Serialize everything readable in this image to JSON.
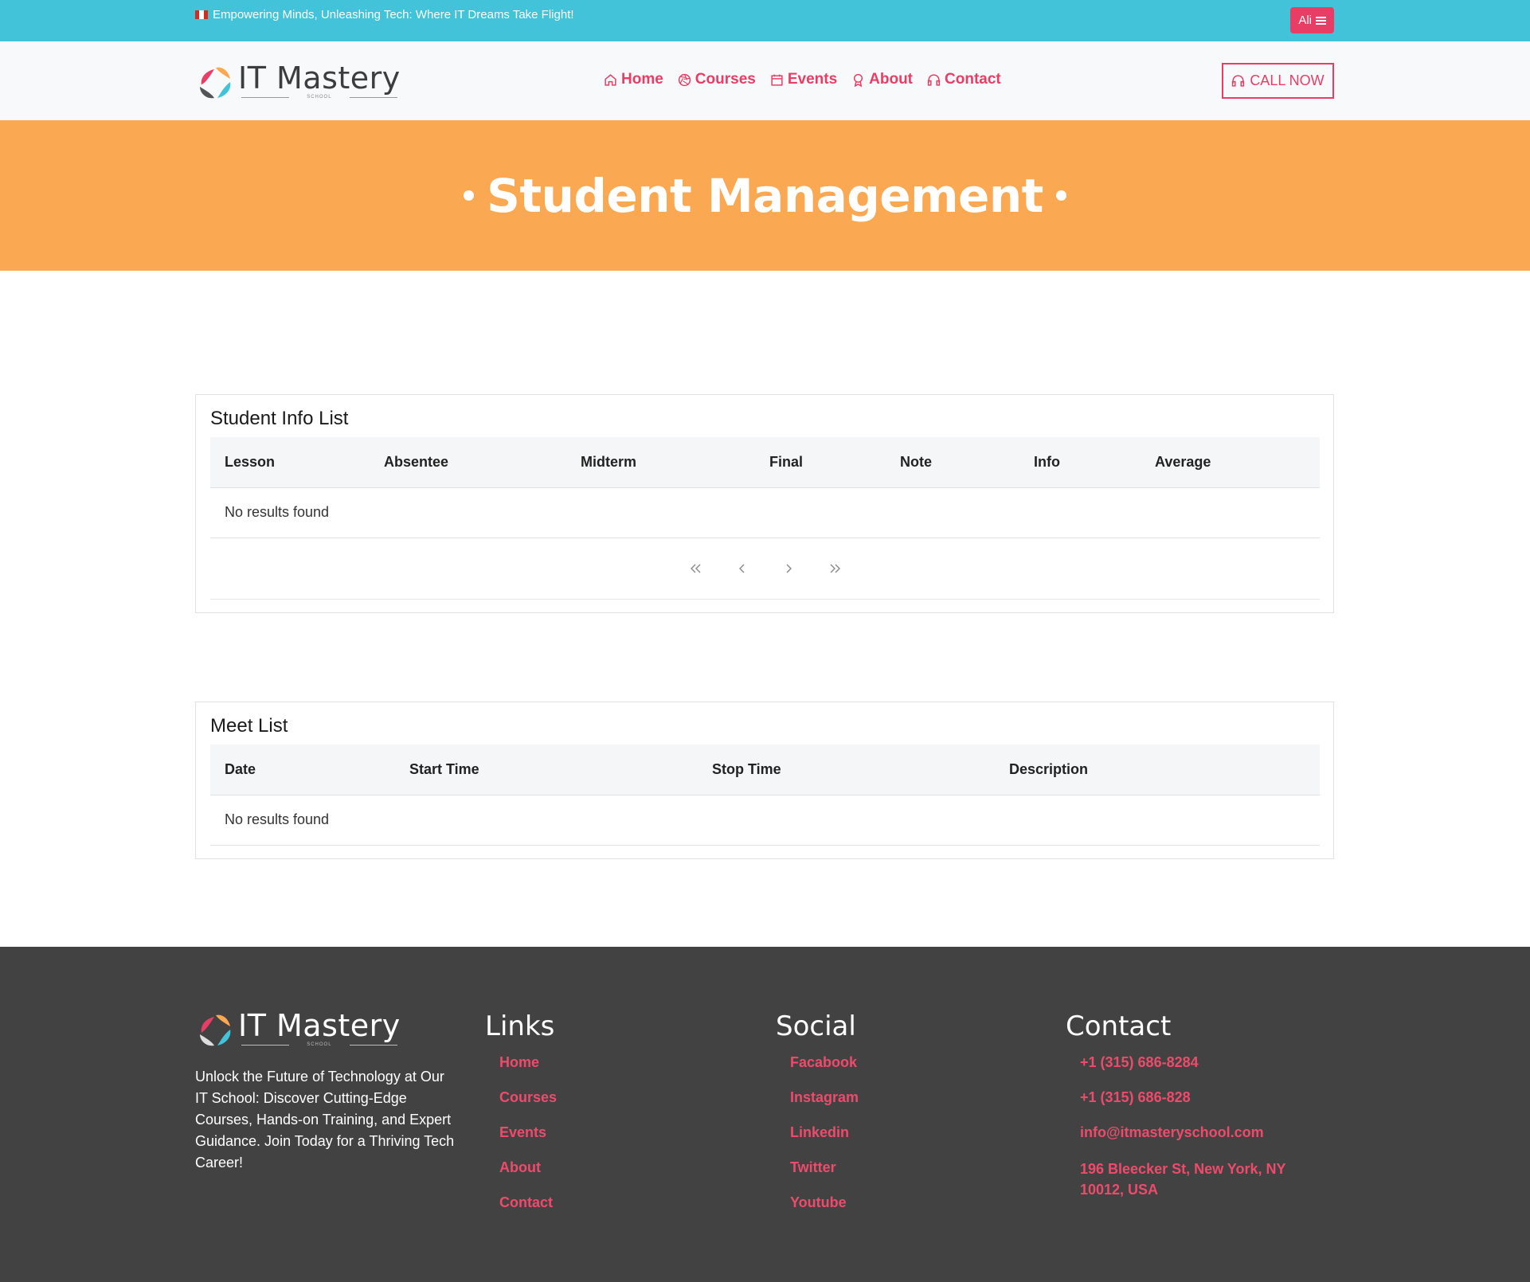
{
  "topbar": {
    "tagline": "Empowering Minds, Unleashing Tech: Where IT Dreams Take Flight!",
    "user_button": "Ali",
    "accent": "#42c3d9"
  },
  "brand": {
    "name": "IT Mastery",
    "subtitle": "SCHOOL"
  },
  "nav": {
    "items": [
      {
        "label": "Home",
        "icon": "home-icon"
      },
      {
        "label": "Courses",
        "icon": "aperture-icon"
      },
      {
        "label": "Events",
        "icon": "calendar-icon"
      },
      {
        "label": "About",
        "icon": "award-icon"
      },
      {
        "label": "Contact",
        "icon": "headphones-icon"
      }
    ],
    "call_button": "CALL NOW",
    "link_color": "#e83e65"
  },
  "hero": {
    "title": "Student Management",
    "background": "#fba852"
  },
  "student_info": {
    "title": "Student Info List",
    "columns": [
      "Lesson",
      "Absentee",
      "Midterm",
      "Final",
      "Note",
      "Info",
      "Average"
    ],
    "empty_text": "No results found",
    "pager": [
      "first-page-icon",
      "previous-page-icon",
      "next-page-icon",
      "last-page-icon"
    ]
  },
  "meet_list": {
    "title": "Meet List",
    "columns": [
      "Date",
      "Start Time",
      "Stop Time",
      "Description"
    ],
    "empty_text": "No results found"
  },
  "footer": {
    "about": "Unlock the Future of Technology at Our IT School: Discover Cutting-Edge Courses, Hands-on Training, and Expert Guidance. Join Today for a Thriving Tech Career!",
    "links": {
      "title": "Links",
      "items": [
        "Home",
        "Courses",
        "Events",
        "About",
        "Contact"
      ]
    },
    "social": {
      "title": "Social",
      "items": [
        "Facabook",
        "Instagram",
        "Linkedin",
        "Twitter",
        "Youtube"
      ]
    },
    "contact": {
      "title": "Contact",
      "items": [
        "+1 (315) 686-8284",
        "+1 (315) 686-828",
        "info@itmasteryschool.com",
        "196 Bleecker St, New York, NY 10012, USA"
      ]
    },
    "background": "#424242"
  }
}
